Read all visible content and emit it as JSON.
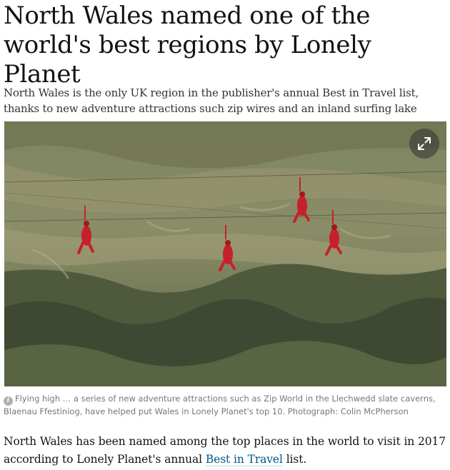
{
  "article": {
    "headline": "North Wales named one of the world's best regions by Lonely Planet",
    "standfirst": "North Wales is the only UK region in the publisher's annual Best in Travel list, thanks to new adventure attractions such zip wires and an inland surfing lake",
    "image": {
      "subject": "four people in red suits on zip wires over a mountain slope",
      "expand_icon": "expand-arrows-icon"
    },
    "caption": {
      "icon": "info-icon",
      "icon_glyph": "i",
      "text": "Flying high … a series of new adventure attractions such as Zip World in the Llechwedd slate caverns, Blaenau Ffestiniog, have helped put Wales in Lonely Planet's top 10. Photograph: Colin McPherson"
    },
    "body": {
      "text_before": "North Wales has been named among the top places in the world to visit in 2017 according to Lonely Planet's annual ",
      "link_text": "Best in Travel",
      "text_after": " list."
    }
  },
  "colors": {
    "text": "#121212",
    "link": "#005689",
    "caption": "#767676",
    "zipliner_suit": "#c8202a"
  }
}
